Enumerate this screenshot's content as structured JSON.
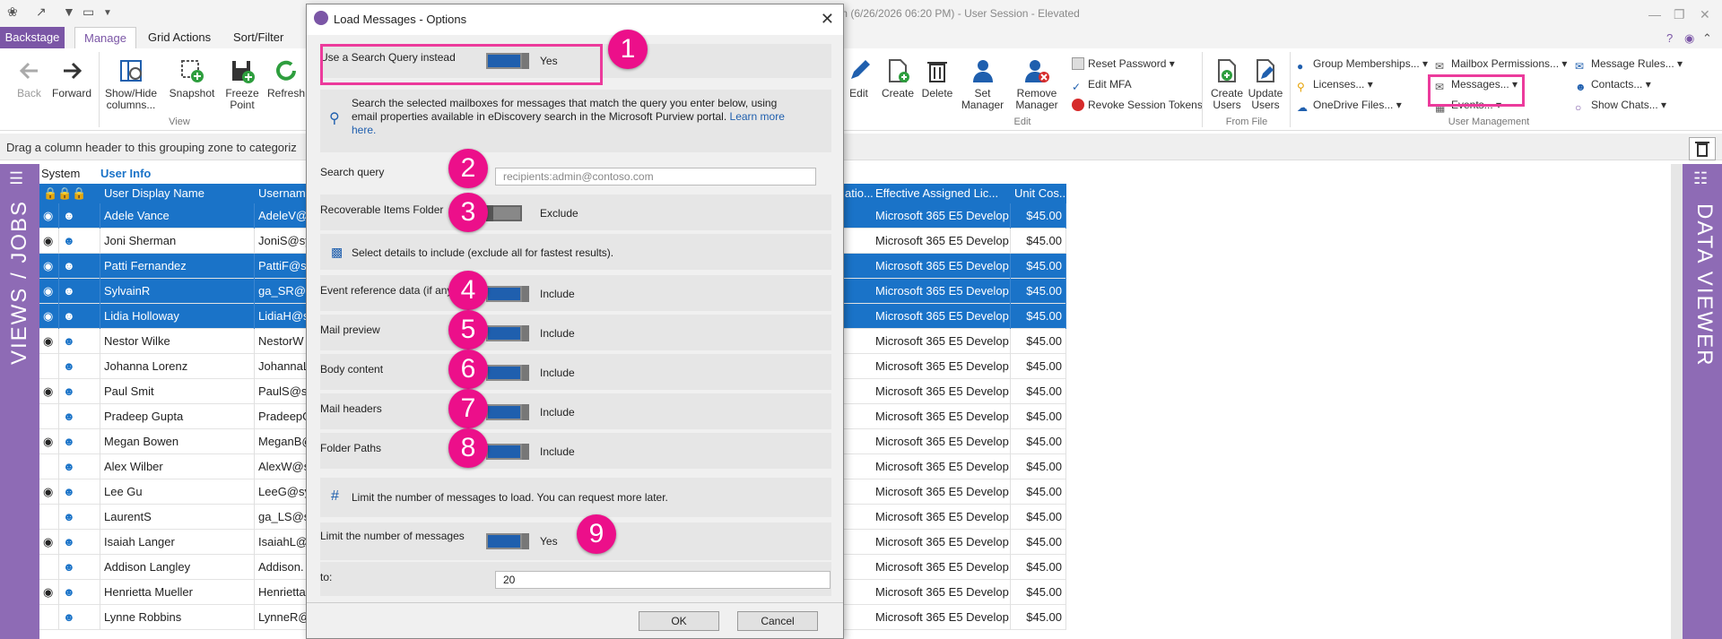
{
  "app": {
    "title": "m (6/26/2026 06:20 PM) - User Session - Elevated"
  },
  "tabs": [
    "Backstage",
    "Manage",
    "Grid Actions",
    "Sort/Filter"
  ],
  "ribbon": {
    "back": "Back",
    "forward": "Forward",
    "show_hide": "Show/Hide columns...",
    "snapshot": "Snapshot",
    "freeze": "Freeze Point",
    "refresh": "Refresh",
    "view_group": "View",
    "edit": "Edit",
    "create": "Create",
    "delete": "Delete",
    "set_manager": "Set Manager",
    "remove_manager": "Remove Manager",
    "reset_password": "Reset Password",
    "edit_mfa": "Edit MFA",
    "revoke": "Revoke Session Tokens",
    "edit_group": "Edit",
    "create_users": "Create Users",
    "update_users": "Update Users",
    "from_file": "From File",
    "group_memberships": "Group Memberships...",
    "licenses": "Licenses...",
    "onedrive": "OneDrive Files...",
    "mailbox_permissions": "Mailbox Permissions...",
    "messages": "Messages...",
    "events": "Events...",
    "message_rules": "Message Rules...",
    "contacts": "Contacts...",
    "show_chats": "Show Chats...",
    "user_management": "User Management"
  },
  "groupzone": "Drag a column header to this grouping zone to categoriz",
  "side": {
    "left": "VIEWS / JOBS",
    "right": "DATA VIEWER"
  },
  "grid": {
    "group_system": "System",
    "group_user_info": "User Info",
    "cols": {
      "display": "User Display Name",
      "username": "Usernam",
      "ratio": "atio...",
      "license": "Effective Assigned Lic...",
      "cost": "Unit Cos..."
    },
    "rows": [
      {
        "name": "Adele Vance",
        "user": "AdeleV@",
        "lic": "Microsoft 365 E5 Develop",
        "cost": "$45.00",
        "sel": true
      },
      {
        "name": "Joni Sherman",
        "user": "JoniS@sy",
        "lic": "Microsoft 365 E5 Develop",
        "cost": "$45.00",
        "sel": false
      },
      {
        "name": "Patti Fernandez",
        "user": "PattiF@sy",
        "lic": "Microsoft 365 E5 Develop",
        "cost": "$45.00",
        "sel": true
      },
      {
        "name": "SylvainR",
        "user": "ga_SR@sy",
        "lic": "Microsoft 365 E5 Develop",
        "cost": "$45.00",
        "sel": true
      },
      {
        "name": "Lidia Holloway",
        "user": "LidiaH@s",
        "lic": "Microsoft 365 E5 Develop",
        "cost": "$45.00",
        "sel": true
      },
      {
        "name": "Nestor Wilke",
        "user": "NestorW",
        "lic": "Microsoft 365 E5 Develop",
        "cost": "$45.00",
        "sel": false
      },
      {
        "name": "Johanna Lorenz",
        "user": "JohannaL",
        "lic": "Microsoft 365 E5 Develop",
        "cost": "$45.00",
        "sel": false
      },
      {
        "name": "Paul Smit",
        "user": "PaulS@sy",
        "lic": "Microsoft 365 E5 Develop",
        "cost": "$45.00",
        "sel": false
      },
      {
        "name": "Pradeep Gupta",
        "user": "PradeepG",
        "lic": "Microsoft 365 E5 Develop",
        "cost": "$45.00",
        "sel": false
      },
      {
        "name": "Megan Bowen",
        "user": "MeganB@",
        "lic": "Microsoft 365 E5 Develop",
        "cost": "$45.00",
        "sel": false
      },
      {
        "name": "Alex Wilber",
        "user": "AlexW@sy",
        "lic": "Microsoft 365 E5 Develop",
        "cost": "$45.00",
        "sel": false
      },
      {
        "name": "Lee Gu",
        "user": "LeeG@sy",
        "lic": "Microsoft 365 E5 Develop",
        "cost": "$45.00",
        "sel": false
      },
      {
        "name": "LaurentS",
        "user": "ga_LS@sy",
        "lic": "Microsoft 365 E5 Develop",
        "cost": "$45.00",
        "sel": false
      },
      {
        "name": "Isaiah Langer",
        "user": "IsaiahL@",
        "lic": "Microsoft 365 E5 Develop",
        "cost": "$45.00",
        "sel": false
      },
      {
        "name": "Addison Langley",
        "user": "Addison.",
        "lic": "Microsoft 365 E5 Develop",
        "cost": "$45.00",
        "sel": false
      },
      {
        "name": "Henrietta Mueller",
        "user": "Henrietta",
        "lic": "Microsoft 365 E5 Develop",
        "cost": "$45.00",
        "sel": false
      },
      {
        "name": "Lynne Robbins",
        "user": "LynneR@",
        "lic": "Microsoft 365 E5 Develop",
        "cost": "$45.00",
        "sel": false
      }
    ]
  },
  "dialog": {
    "title": "Load Messages - Options",
    "use_search_query": "Use a Search Query instead",
    "use_search_value": "Yes",
    "info_text": "Search the selected mailboxes for messages that match the query you enter below, using email properties available in eDiscovery search in the Microsoft Purview portal.",
    "learn_more": "Learn more here.",
    "search_query_label": "Search query",
    "search_query_placeholder": "recipients:admin@contoso.com",
    "recoverable_label": "Recoverable Items Folder",
    "recoverable_value": "Exclude",
    "details_text": "Select details to include (exclude all for fastest results).",
    "event_ref_label": "Event reference data (if any)",
    "mail_preview_label": "Mail preview",
    "body_label": "Body content",
    "headers_label": "Mail headers",
    "folder_label": "Folder Paths",
    "include": "Include",
    "limit_text": "Limit the number of messages to load. You can request more later.",
    "limit_label": "Limit the number of messages",
    "limit_value": "Yes",
    "to_label": "to:",
    "to_value": "20",
    "ok": "OK",
    "cancel": "Cancel"
  },
  "callouts": [
    "1",
    "2",
    "3",
    "4",
    "5",
    "6",
    "7",
    "8",
    "9"
  ],
  "colors": {
    "accent": "#7b56a6",
    "selection": "#1a73c8",
    "toggle_on": "#1f5fae",
    "callout": "#ec0f8a"
  }
}
